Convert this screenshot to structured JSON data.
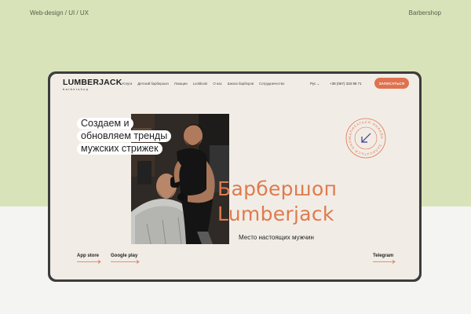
{
  "header": {
    "left_caption": "Web-design / UI / UX",
    "right_caption": "Barbershop"
  },
  "site": {
    "logo": {
      "main": "LUMBERJACK",
      "sub": "barbershop"
    },
    "nav": [
      "Услуги",
      "Детский барбершоп",
      "Локации",
      "Lookbook",
      "О нас",
      "Школа барберов",
      "Сотрудничество"
    ],
    "lang": "Рус",
    "phone": "+38 (067) 333 98 71",
    "book_button": "ЗАПИСАТЬСЯ",
    "tagline": [
      "Создаем и",
      "обновляем тренды",
      "мужских стрижек"
    ],
    "hero_title": [
      "Барбершоп",
      "Lumberjack"
    ],
    "hero_subtitle": "Место настоящих мужчин",
    "stamp_text": "ЗАПИСАТЬСЯ ОНЛАЙН · ЗАПИСАТЬСЯ ОНЛАЙН ·",
    "links": {
      "app_store": "App store",
      "google_play": "Google play",
      "telegram": "Telegram"
    }
  },
  "colors": {
    "accent": "#e1724f",
    "background_top": "#d9e3b9",
    "site_bg": "#f1ede6",
    "frame": "#3c3c3c"
  }
}
